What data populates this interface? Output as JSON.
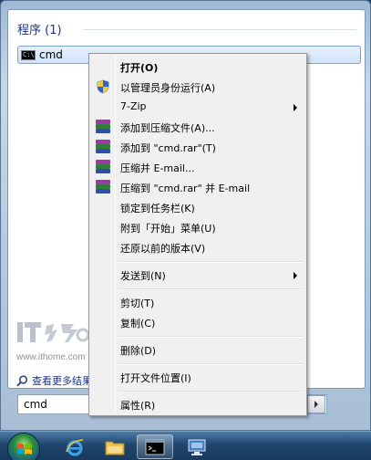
{
  "start_menu": {
    "section_title": "程序 (1)",
    "result": {
      "label": "cmd",
      "icon": "cmd-prompt-icon",
      "icon_text": "C:\\"
    },
    "watermark": {
      "logo_text": "IT之家",
      "url": "www.ithome.com"
    },
    "more_results_label": "查看更多结果",
    "search": {
      "value": "cmd"
    }
  },
  "context_menu": {
    "items": [
      {
        "label": "打开(O)",
        "bold": true,
        "icon": ""
      },
      {
        "label": "以管理员身份运行(A)",
        "icon": "uac-shield-icon"
      },
      {
        "label": "7-Zip",
        "submenu": true,
        "icon": ""
      },
      {
        "label": "添加到压缩文件(A)...",
        "icon": "winrar-icon"
      },
      {
        "label": "添加到 \"cmd.rar\"(T)",
        "icon": "winrar-icon"
      },
      {
        "label": "压缩并 E-mail...",
        "icon": "winrar-icon"
      },
      {
        "label": "压缩到 \"cmd.rar\" 并 E-mail",
        "icon": "winrar-icon"
      },
      {
        "label": "锁定到任务栏(K)",
        "icon": ""
      },
      {
        "label": "附到「开始」菜单(U)",
        "icon": ""
      },
      {
        "label": "还原以前的版本(V)",
        "icon": ""
      },
      {
        "label": "发送到(N)",
        "submenu": true,
        "icon": ""
      },
      {
        "label": "剪切(T)",
        "icon": ""
      },
      {
        "label": "复制(C)",
        "icon": ""
      },
      {
        "label": "删除(D)",
        "icon": ""
      },
      {
        "label": "打开文件位置(I)",
        "icon": ""
      },
      {
        "label": "属性(R)",
        "icon": ""
      }
    ]
  },
  "taskbar": {
    "buttons": [
      {
        "name": "internet-explorer",
        "icon": "ie-icon"
      },
      {
        "name": "windows-explorer",
        "icon": "folder-icon"
      },
      {
        "name": "command-prompt",
        "icon": "cmd-prompt-icon"
      },
      {
        "name": "remote-desktop",
        "icon": "remote-desktop-icon"
      }
    ]
  },
  "colors": {
    "link_blue": "#1e3287",
    "selection_border": "#7da2ce",
    "menu_background": "#f0f0f0"
  }
}
